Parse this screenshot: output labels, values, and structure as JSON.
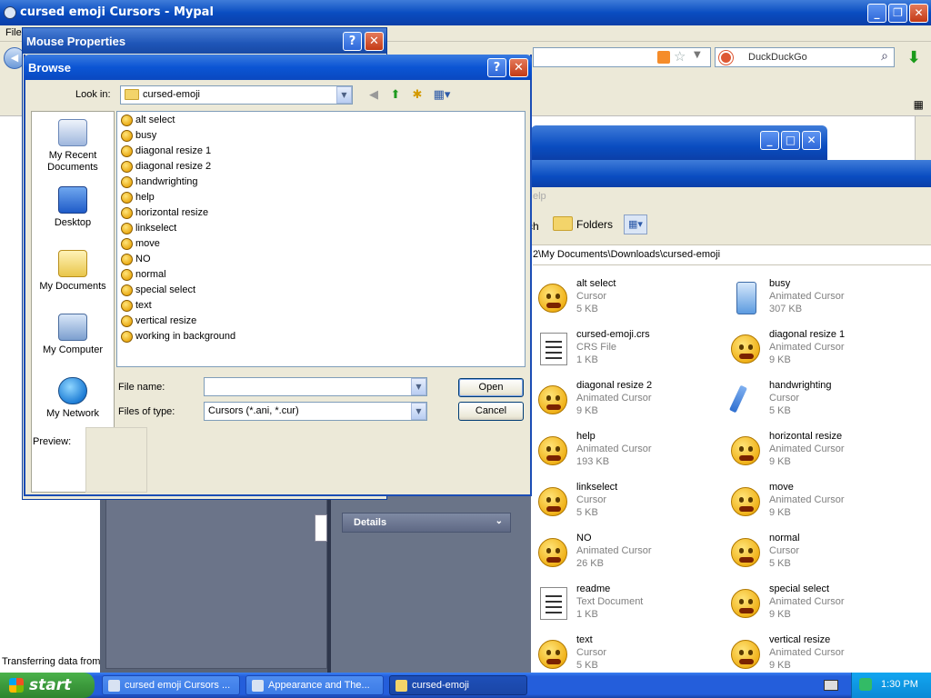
{
  "browser": {
    "title": "cursed emoji Cursors - Mypal",
    "menu_first": "File",
    "search_placeholder": "DuckDuckGo",
    "status_text": "Transferring data from"
  },
  "explorer": {
    "menu_partial": "elp",
    "toolbar_search_partial": "ch",
    "toolbar_folders": "Folders",
    "address": "2\\My Documents\\Downloads\\cursed-emoji",
    "details_label": "Details",
    "files": [
      {
        "name": "alt select",
        "type": "Cursor",
        "size": "5 KB",
        "icon": "emoji-cursor-icon"
      },
      {
        "name": "busy",
        "type": "Animated Cursor",
        "size": "307 KB",
        "icon": "hourglass-cursor-icon"
      },
      {
        "name": "cursed-emoji.crs",
        "type": "CRS File",
        "size": "1 KB",
        "icon": "crs-file-icon"
      },
      {
        "name": "diagonal resize 1",
        "type": "Animated Cursor",
        "size": "9 KB",
        "icon": "emoji-cursor-icon"
      },
      {
        "name": "diagonal resize 2",
        "type": "Animated Cursor",
        "size": "9 KB",
        "icon": "emoji-cursor-icon"
      },
      {
        "name": "handwrighting",
        "type": "Cursor",
        "size": "5 KB",
        "icon": "pen-cursor-icon"
      },
      {
        "name": "help",
        "type": "Animated Cursor",
        "size": "193 KB",
        "icon": "emoji-cursor-icon"
      },
      {
        "name": "horizontal resize",
        "type": "Animated Cursor",
        "size": "9 KB",
        "icon": "emoji-cursor-icon"
      },
      {
        "name": "linkselect",
        "type": "Cursor",
        "size": "5 KB",
        "icon": "emoji-cursor-icon"
      },
      {
        "name": "move",
        "type": "Animated Cursor",
        "size": "9 KB",
        "icon": "emoji-cursor-icon"
      },
      {
        "name": "NO",
        "type": "Animated Cursor",
        "size": "26 KB",
        "icon": "emoji-cursor-icon"
      },
      {
        "name": "normal",
        "type": "Cursor",
        "size": "5 KB",
        "icon": "emoji-cursor-icon"
      },
      {
        "name": "readme",
        "type": "Text Document",
        "size": "1 KB",
        "icon": "text-document-icon"
      },
      {
        "name": "special select",
        "type": "Animated Cursor",
        "size": "9 KB",
        "icon": "emoji-cursor-icon"
      },
      {
        "name": "text",
        "type": "Cursor",
        "size": "5 KB",
        "icon": "emoji-cursor-icon"
      },
      {
        "name": "vertical resize",
        "type": "Animated Cursor",
        "size": "9 KB",
        "icon": "emoji-cursor-icon"
      }
    ]
  },
  "mouse_properties": {
    "title": "Mouse Properties",
    "help": "?",
    "close": "✕"
  },
  "browse": {
    "title": "Browse",
    "help": "?",
    "close": "✕",
    "look_in_label": "Look in:",
    "look_in_value": "cursed-emoji",
    "places": [
      {
        "label": "My Recent Documents",
        "icon": "recent-documents-icon"
      },
      {
        "label": "Desktop",
        "icon": "desktop-icon"
      },
      {
        "label": "My Documents",
        "icon": "my-documents-icon"
      },
      {
        "label": "My Computer",
        "icon": "my-computer-icon"
      },
      {
        "label": "My Network",
        "icon": "my-network-icon"
      }
    ],
    "files": [
      "alt select",
      "busy",
      "diagonal resize 1",
      "diagonal resize 2",
      "handwrighting",
      "help",
      "horizontal resize",
      "linkselect",
      "move",
      "NO",
      "normal",
      "special select",
      "text",
      "vertical resize",
      "working in background"
    ],
    "file_name_label": "File name:",
    "file_name_value": "",
    "files_of_type_label": "Files of type:",
    "files_of_type_value": "Cursors (*.ani, *.cur)",
    "open_button": "Open",
    "cancel_button": "Cancel",
    "preview_label": "Preview:"
  },
  "taskbar": {
    "start_label": "start",
    "tasks": [
      {
        "label": "cursed emoji Cursors ...",
        "active": false
      },
      {
        "label": "Appearance and The...",
        "active": false
      },
      {
        "label": "cursed-emoji",
        "active": true
      }
    ],
    "clock": "1:30 PM"
  }
}
